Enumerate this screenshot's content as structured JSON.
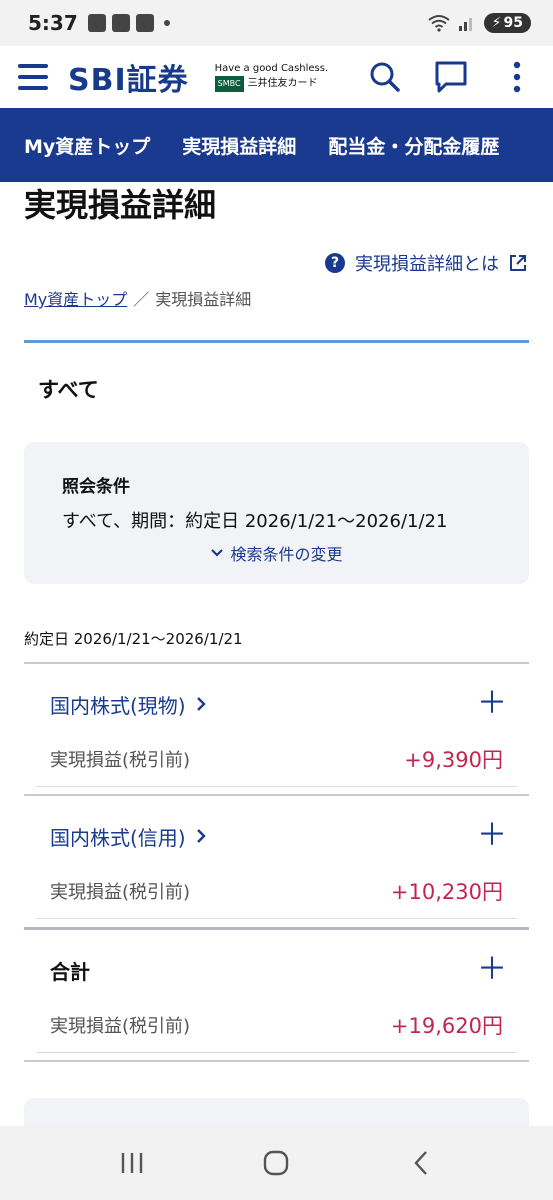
{
  "status": {
    "time": "5:37",
    "battery": "95"
  },
  "header": {
    "logo": "SBI証券",
    "cashless_tagline": "Have a good Cashless.",
    "smbc_label": "SMBC",
    "card_label": "三井住友カード"
  },
  "nav": {
    "items": [
      "My資産トップ",
      "実現損益詳細",
      "配当金・分配金履歴"
    ]
  },
  "page": {
    "title": "実現損益詳細",
    "help_link": "実現損益詳細とは",
    "breadcrumb_home": "My資産トップ",
    "breadcrumb_sep": "／",
    "breadcrumb_current": "実現損益詳細",
    "tab_all": "すべて"
  },
  "conditions": {
    "title": "照会条件",
    "text": "すべて、期間：約定日 2026/1/21〜2026/1/21",
    "change_label": "検索条件の変更"
  },
  "date_label": "約定日 2026/1/21〜2026/1/21",
  "sections": [
    {
      "name": "国内株式(現物)",
      "row_label": "実現損益(税引前)",
      "value": "+9,390円"
    },
    {
      "name": "国内株式(信用)",
      "row_label": "実現損益(税引前)",
      "value": "+10,230円"
    },
    {
      "name": "合計",
      "row_label": "実現損益(税引前)",
      "value": "+19,620円"
    }
  ],
  "colors": {
    "brand_navy": "#1a3a8f",
    "positive_red": "#c2264f",
    "tab_accent": "#5a9bd8"
  }
}
